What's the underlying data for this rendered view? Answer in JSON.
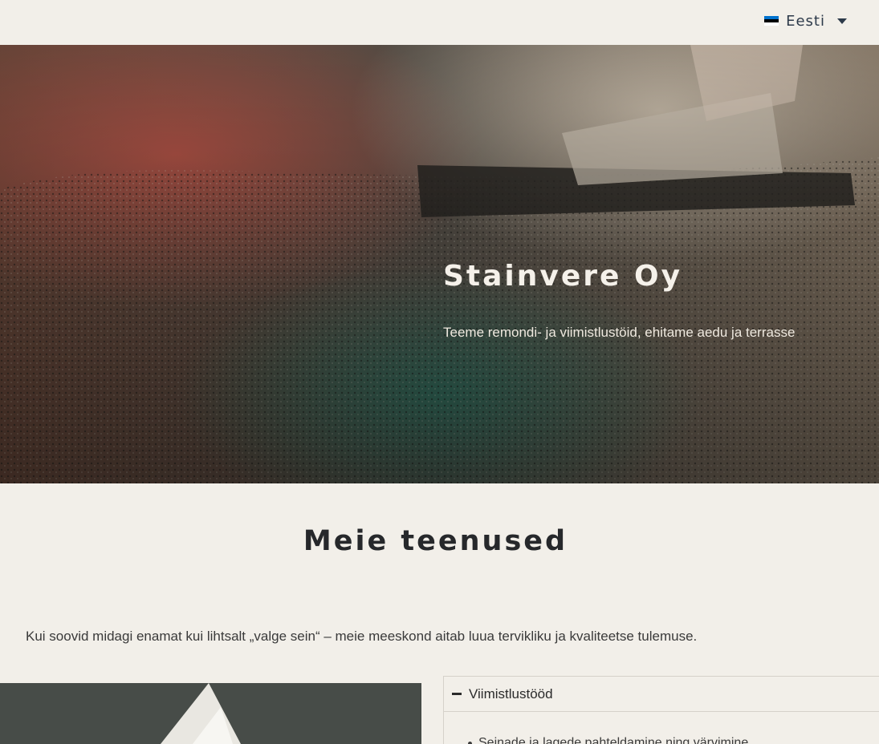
{
  "header": {
    "language": {
      "label": "Eesti",
      "flag_colors": [
        "#0072ce",
        "#000000",
        "#ffffff"
      ]
    }
  },
  "hero": {
    "title": "Stainvere Oy",
    "subtitle": "Teeme  remondi- ja viimistlustöid,  ehitame aedu ja terrasse"
  },
  "services": {
    "title": "Meie teenused",
    "intro": "Kui soovid midagi enamat kui lihtsalt „valge sein“ – meie meeskond aitab luua tervikliku ja kvaliteetse tulemuse.",
    "accordion": {
      "title": "Viimistlustööd",
      "items": [
        "Seinade ja lagede pahteldamine ning värvimine"
      ]
    }
  },
  "colors": {
    "background": "#f2efe9",
    "heading": "#26282b",
    "hero_text": "#f5f1ea"
  }
}
